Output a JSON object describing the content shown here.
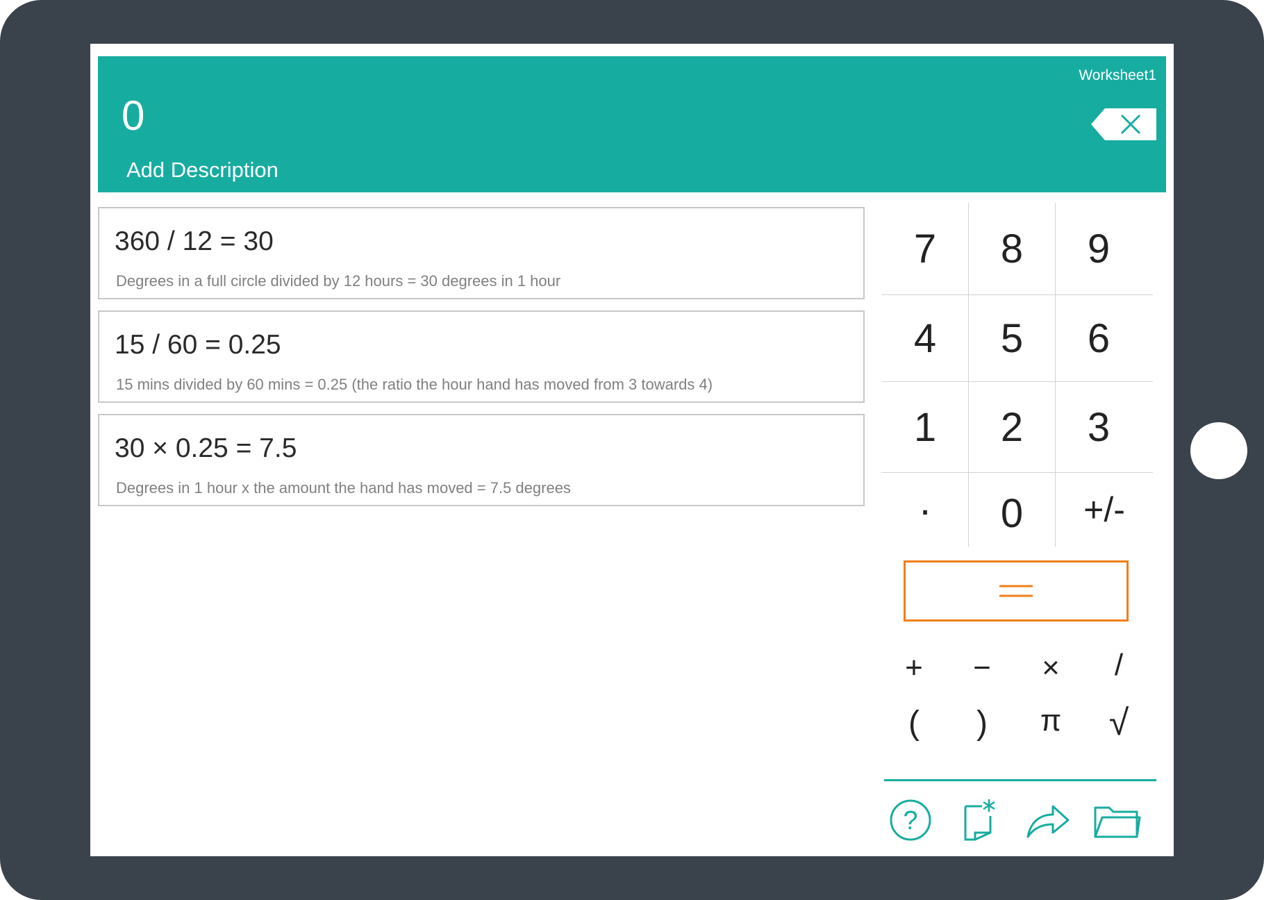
{
  "header": {
    "sheet_name": "Worksheet1",
    "display_value": "0",
    "description": "Add Description"
  },
  "worksheet": {
    "rows": [
      {
        "expression": "360 / 12 = 30",
        "description": "Degrees in a full circle divided by 12 hours = 30 degrees in 1 hour"
      },
      {
        "expression": "15 / 60 = 0.25",
        "description": "15 mins divided by 60 mins = 0.25 (the ratio the hour hand has moved from 3 towards 4)"
      },
      {
        "expression": "30 × 0.25 = 7.5",
        "description": "Degrees in 1 hour x the amount the hand has moved = 7.5 degrees"
      }
    ]
  },
  "keypad": {
    "digits": [
      "7",
      "8",
      "9",
      "4",
      "5",
      "6",
      "1",
      "2",
      "3",
      "·",
      "0",
      "+/-"
    ],
    "operators": [
      "+",
      "−",
      "×",
      "/",
      "(",
      ")",
      "π",
      "√"
    ]
  },
  "colors": {
    "accent": "#17aca0",
    "equals": "#f07f1a",
    "device": "#3a424b"
  },
  "toolbar": {
    "icons": [
      "help-icon",
      "new-sheet-icon",
      "share-icon",
      "folder-icon"
    ]
  }
}
